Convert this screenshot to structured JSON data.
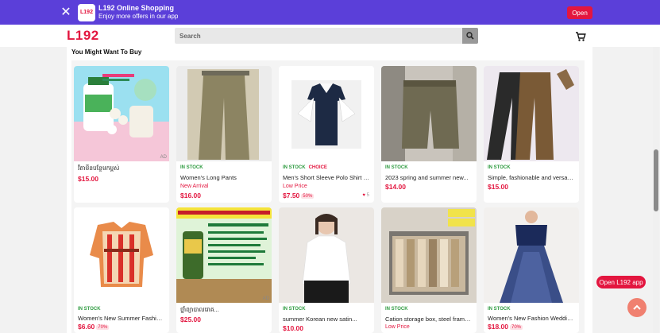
{
  "banner": {
    "title": "L192 Online Shopping",
    "subtitle": "Enjoy more offers in our app",
    "logo_text": "L192",
    "open_label": "Open",
    "close_icon": "close-icon"
  },
  "header": {
    "brand": "L192",
    "search_placeholder": "Search",
    "search_icon": "search-icon",
    "cart_icon": "cart-icon"
  },
  "section_title": "You Might Want To Buy",
  "products": [
    {
      "name": "វីតាមីនបន្ថែមកម្ពស់",
      "stock": "",
      "choice": "",
      "tag": "",
      "price": "$15.00",
      "discount": "",
      "likes": "",
      "ad": "AD"
    },
    {
      "name": "Women's Long Pants",
      "stock": "IN STOCK",
      "choice": "",
      "tag": "New Arrival",
      "price": "$16.00",
      "discount": "",
      "likes": "",
      "ad": ""
    },
    {
      "name": "Men's Short Sleeve Polo Shirt with...",
      "stock": "IN STOCK",
      "choice": "CHOICE",
      "tag": "Low Price",
      "price": "$7.50",
      "discount": "50%",
      "likes": "5",
      "ad": ""
    },
    {
      "name": "2023 spring and summer new...",
      "stock": "IN STOCK",
      "choice": "",
      "tag": "",
      "price": "$14.00",
      "discount": "",
      "likes": "",
      "ad": ""
    },
    {
      "name": "Simple, fashionable and versatile...",
      "stock": "IN STOCK",
      "choice": "",
      "tag": "",
      "price": "$15.00",
      "discount": "",
      "likes": "",
      "ad": ""
    },
    {
      "name": "Women's New Summer Fashion...",
      "stock": "IN STOCK",
      "choice": "",
      "tag": "",
      "price": "$6.60",
      "discount": "70%",
      "likes": "",
      "ad": ""
    },
    {
      "name": "ថ្នាំព្យាបាលរោគ...",
      "stock": "",
      "choice": "",
      "tag": "",
      "price": "$25.00",
      "discount": "",
      "likes": "",
      "ad": "AD"
    },
    {
      "name": "summer Korean new satin...",
      "stock": "IN STOCK",
      "choice": "",
      "tag": "",
      "price": "$10.00",
      "discount": "",
      "likes": "",
      "ad": ""
    },
    {
      "name": "Cation storage box, steel frame,...",
      "stock": "IN STOCK",
      "choice": "",
      "tag": "Low Price",
      "price": "",
      "discount": "",
      "likes": "",
      "ad": ""
    },
    {
      "name": "Women's New Fashion Wedding...",
      "stock": "IN STOCK",
      "choice": "",
      "tag": "",
      "price": "$18.00",
      "discount": "70%",
      "likes": "",
      "ad": ""
    }
  ],
  "floating": {
    "open_app_label": "Open L192 app",
    "back_to_top_icon": "arrow-up-icon"
  },
  "colors": {
    "brand_red": "#e3163f",
    "banner_purple": "#5b3fd9",
    "stock_green": "#2e9b40"
  }
}
